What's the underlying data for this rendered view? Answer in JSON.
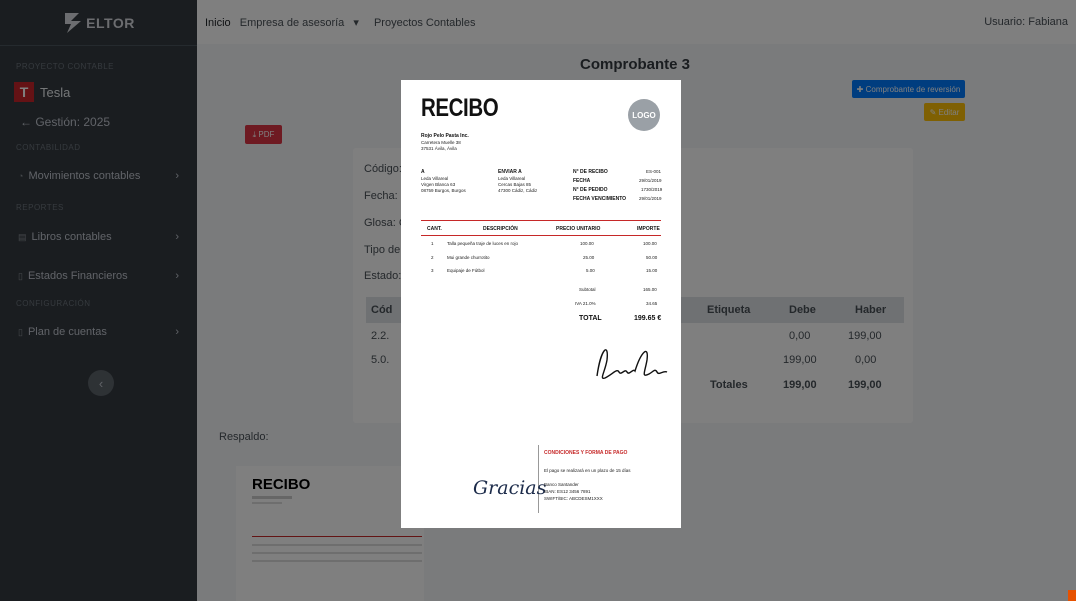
{
  "sidebar": {
    "brand": "ELTOR",
    "section_project": "PROYECTO CONTABLE",
    "project_name": "Tesla",
    "management": "← Gestión: 2025",
    "section_accounting": "CONTABILIDAD",
    "item_movements": "Movimientos contables",
    "section_reports": "REPORTES",
    "item_books": "Libros contables",
    "item_financial": "Estados Financieros",
    "section_config": "CONFIGURACIÓN",
    "item_accounts": "Plan de cuentas"
  },
  "topbar": {
    "home": "Inicio",
    "company": "Empresa de asesoría",
    "projects": "Proyectos Contables",
    "user": "Usuario: Fabiana"
  },
  "page": {
    "title": "Comprobante 3",
    "pdf_button": "PDF",
    "reversal_button": "Comprobante de reversión",
    "edit_button": "Editar",
    "code_label": "Código:",
    "date_label": "Fecha: 2",
    "gloss_label": "Glosa: C",
    "type_label": "Tipo de",
    "state_label": "Estado:",
    "respaldo": "Respaldo:"
  },
  "table": {
    "headers": [
      "Cód",
      "Etiqueta",
      "Debe",
      "Haber"
    ],
    "rows": [
      {
        "code": "2.2.",
        "debe": "0,00",
        "haber": "199,00"
      },
      {
        "code": "5.0.",
        "debe": "199,00",
        "haber": "0,00"
      }
    ],
    "totals_label": "Totales",
    "totals_debe": "199,00",
    "totals_haber": "199,00"
  },
  "receipt": {
    "title": "RECIBO",
    "logo": "LOGO",
    "company": "Rojo Pelo Pasta Inc.",
    "company_addr1": "Carretera Muelle 38",
    "company_addr2": "37531 Ávila, Ávila",
    "to_label": "A",
    "to_1": "Leda Villareal",
    "to_2": "Virgen Blanca 63",
    "to_3": "08759 Burgos, Burgos",
    "ship_label": "ENVIAR A",
    "ship_1": "Leda Villareal",
    "ship_2": "Cercas Bajas 85",
    "ship_3": "47300 Cádiz, Cádiz",
    "meta_labels": [
      "N° DE RECIBO",
      "FECHA",
      "N° DE PEDIDO",
      "FECHA VENCIMIENTO"
    ],
    "meta_values": [
      "ES-001",
      "29/01/2019",
      "1730/2019",
      "29/01/2019"
    ],
    "col_qty": "CANT.",
    "col_desc": "DESCRIPCIÓN",
    "col_price": "PRECIO UNITARIO",
    "col_amount": "IMPORTE",
    "items": [
      {
        "qty": "1",
        "desc": "Talla pequeña traje de luces en rojo",
        "price": "100.00",
        "amount": "100.00"
      },
      {
        "qty": "2",
        "desc": "Mui grande churrotito",
        "price": "25.00",
        "amount": "50.00"
      },
      {
        "qty": "3",
        "desc": "Equipaje de Fútbol",
        "price": "5.00",
        "amount": "15.00"
      }
    ],
    "subtotal_label": "Subtotal",
    "subtotal": "165.00",
    "iva_label": "IVA 21.0%",
    "iva": "34.65",
    "total_label": "TOTAL",
    "total": "199.65 €",
    "signature": "Laura García",
    "thanks": "Gracias",
    "terms_title": "CONDICIONES Y FORMA DE PAGO",
    "terms_1": "El pago se realizará en un plazo de 15 días",
    "terms_2": "Banco Santander",
    "terms_3": "IBAN: ES12 3456 7891",
    "terms_4": "SWIFT/BIC: ABCDESM1XXX"
  },
  "colors": {
    "sidebar": "#343a40",
    "primary": "#007bff",
    "danger": "#dc3545",
    "warning": "#ffc107",
    "accent_red": "#c62828"
  }
}
